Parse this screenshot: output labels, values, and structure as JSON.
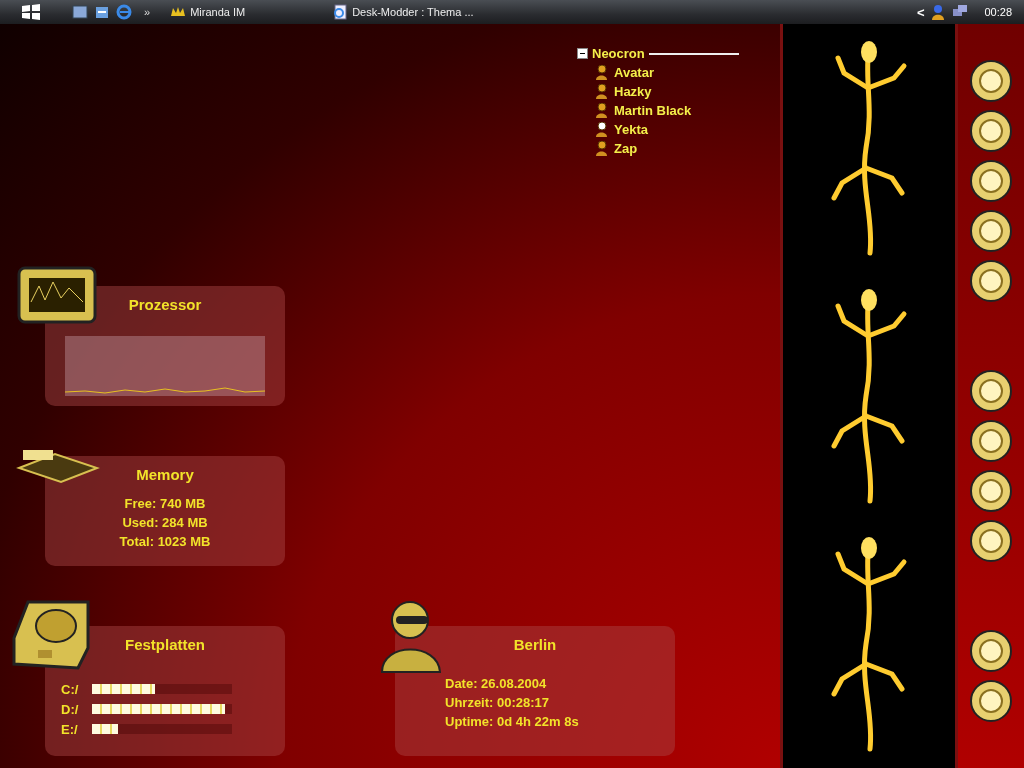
{
  "taskbar": {
    "quick_launch_more": "»",
    "tasks": [
      {
        "label": "Miranda IM",
        "kind": "miranda"
      },
      {
        "label": "Desk-Modder : Thema ...",
        "kind": "browser"
      }
    ],
    "tray_toggle": "<",
    "clock": "00:28"
  },
  "contact_list": {
    "group": "Neocron",
    "expanded": true,
    "contacts": [
      {
        "name": "Avatar",
        "away": false
      },
      {
        "name": "Hazky",
        "away": false
      },
      {
        "name": "Martin Black",
        "away": false
      },
      {
        "name": "Yekta",
        "away": true
      },
      {
        "name": "Zap",
        "away": false
      }
    ]
  },
  "cpu_widget": {
    "title": "Prozessor"
  },
  "memory_widget": {
    "title": "Memory",
    "lines": [
      "Free: 740 MB",
      "Used: 284 MB",
      "Total: 1023 MB"
    ]
  },
  "disk_widget": {
    "title": "Festplatten",
    "drives": [
      {
        "label": "C:/",
        "level": 0.45
      },
      {
        "label": "D:/",
        "level": 0.95
      },
      {
        "label": "E:/",
        "level": 0.19
      }
    ]
  },
  "clock_widget": {
    "title": "Berlin",
    "lines": [
      "Date: 26.08.2004",
      "Uhrzeit: 00:28:17",
      "Uptime: 0d 4h 22m 8s"
    ]
  }
}
